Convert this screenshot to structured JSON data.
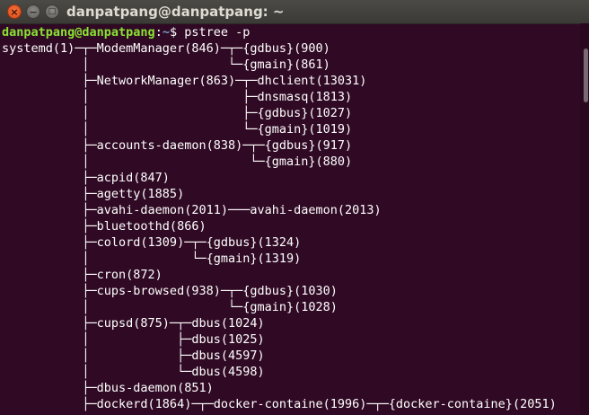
{
  "window": {
    "title": "danpatpang@danpatpang: ~",
    "close_glyph": "×",
    "minimize_glyph": "−",
    "maximize_glyph": "□"
  },
  "prompt": {
    "userhost": "danpatpang@danpatpang",
    "separator": ":",
    "path": "~",
    "symbol": "$ ",
    "command": "pstree -p"
  },
  "output_lines": [
    "systemd(1)─┬─ModemManager(846)─┬─{gdbus}(900)",
    "           │                   └─{gmain}(861)",
    "           ├─NetworkManager(863)─┬─dhclient(13031)",
    "           │                     ├─dnsmasq(1813)",
    "           │                     ├─{gdbus}(1027)",
    "           │                     └─{gmain}(1019)",
    "           ├─accounts-daemon(838)─┬─{gdbus}(917)",
    "           │                      └─{gmain}(880)",
    "           ├─acpid(847)",
    "           ├─agetty(1885)",
    "           ├─avahi-daemon(2011)───avahi-daemon(2013)",
    "           ├─bluetoothd(866)",
    "           ├─colord(1309)─┬─{gdbus}(1324)",
    "           │              └─{gmain}(1319)",
    "           ├─cron(872)",
    "           ├─cups-browsed(938)─┬─{gdbus}(1030)",
    "           │                   └─{gmain}(1028)",
    "           ├─cupsd(875)─┬─dbus(1024)",
    "           │            ├─dbus(1025)",
    "           │            ├─dbus(4597)",
    "           │            └─dbus(4598)",
    "           ├─dbus-daemon(851)",
    "           ├─dockerd(1864)─┬─docker-containe(1996)─┬─{docker-containe}(2051)"
  ],
  "colors": {
    "background": "#300a24",
    "text": "#ffffff",
    "userhost": "#8ae234",
    "path": "#729fcf",
    "titlebar": "#3c3b37"
  }
}
